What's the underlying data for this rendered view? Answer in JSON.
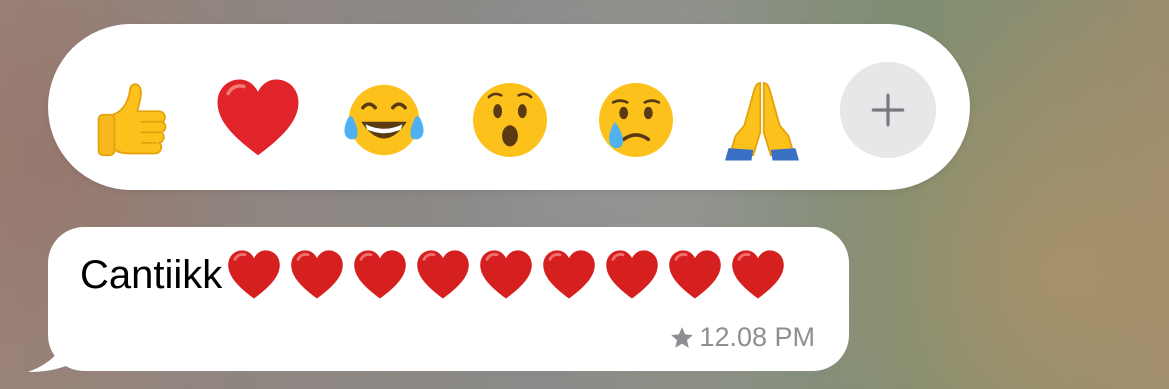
{
  "reaction_bar": {
    "reactions": [
      {
        "name": "thumbs-up-icon"
      },
      {
        "name": "red-heart-icon"
      },
      {
        "name": "tears-of-joy-icon"
      },
      {
        "name": "surprised-face-icon"
      },
      {
        "name": "crying-face-icon"
      },
      {
        "name": "folded-hands-icon"
      }
    ],
    "more_icon": "plus-icon"
  },
  "message": {
    "text": "Cantiikk",
    "heart_count": 9,
    "starred_icon": "star-icon",
    "time": "12.08 PM"
  },
  "colors": {
    "bubble": "#ffffff",
    "heart": "#d61f1f",
    "meta": "#8e8e93",
    "add_button_bg": "#e7e7ea"
  }
}
